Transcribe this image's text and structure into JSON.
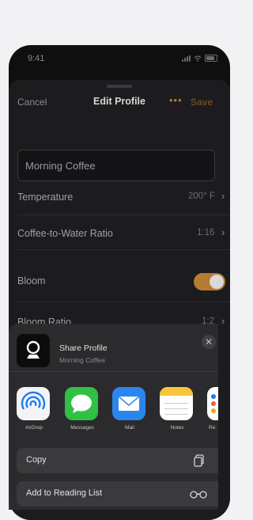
{
  "status": {
    "time": "9:41"
  },
  "nav": {
    "cancel": "Cancel",
    "title": "Edit Profile",
    "more": "•••",
    "save": "Save"
  },
  "form": {
    "name_value": "Morning Coffee",
    "rows": [
      {
        "label": "Temperature",
        "value": "200° F"
      },
      {
        "label": "Coffee-to-Water Ratio",
        "value": "1:16"
      },
      {
        "label": "Bloom",
        "toggle_on": true
      },
      {
        "label": "Bloom Ratio",
        "value": "1:2"
      }
    ]
  },
  "share": {
    "title": "Share Profile",
    "subtitle": "Morning Coffee",
    "close": "✕",
    "apps": [
      {
        "name": "AirDrop",
        "icon": "airdrop-icon"
      },
      {
        "name": "Messages",
        "icon": "messages-icon"
      },
      {
        "name": "Mail",
        "icon": "mail-icon"
      },
      {
        "name": "Notes",
        "icon": "notes-icon"
      },
      {
        "name": "Re",
        "icon": "reminders-icon"
      }
    ],
    "actions": [
      {
        "label": "Copy",
        "icon": "copy-icon"
      },
      {
        "label": "Add to Reading List",
        "icon": "glasses-icon"
      }
    ]
  },
  "colors": {
    "accent": "#b77a32",
    "sheet_bg": "#1c1c1e",
    "share_bg": "#2c2c2e"
  }
}
